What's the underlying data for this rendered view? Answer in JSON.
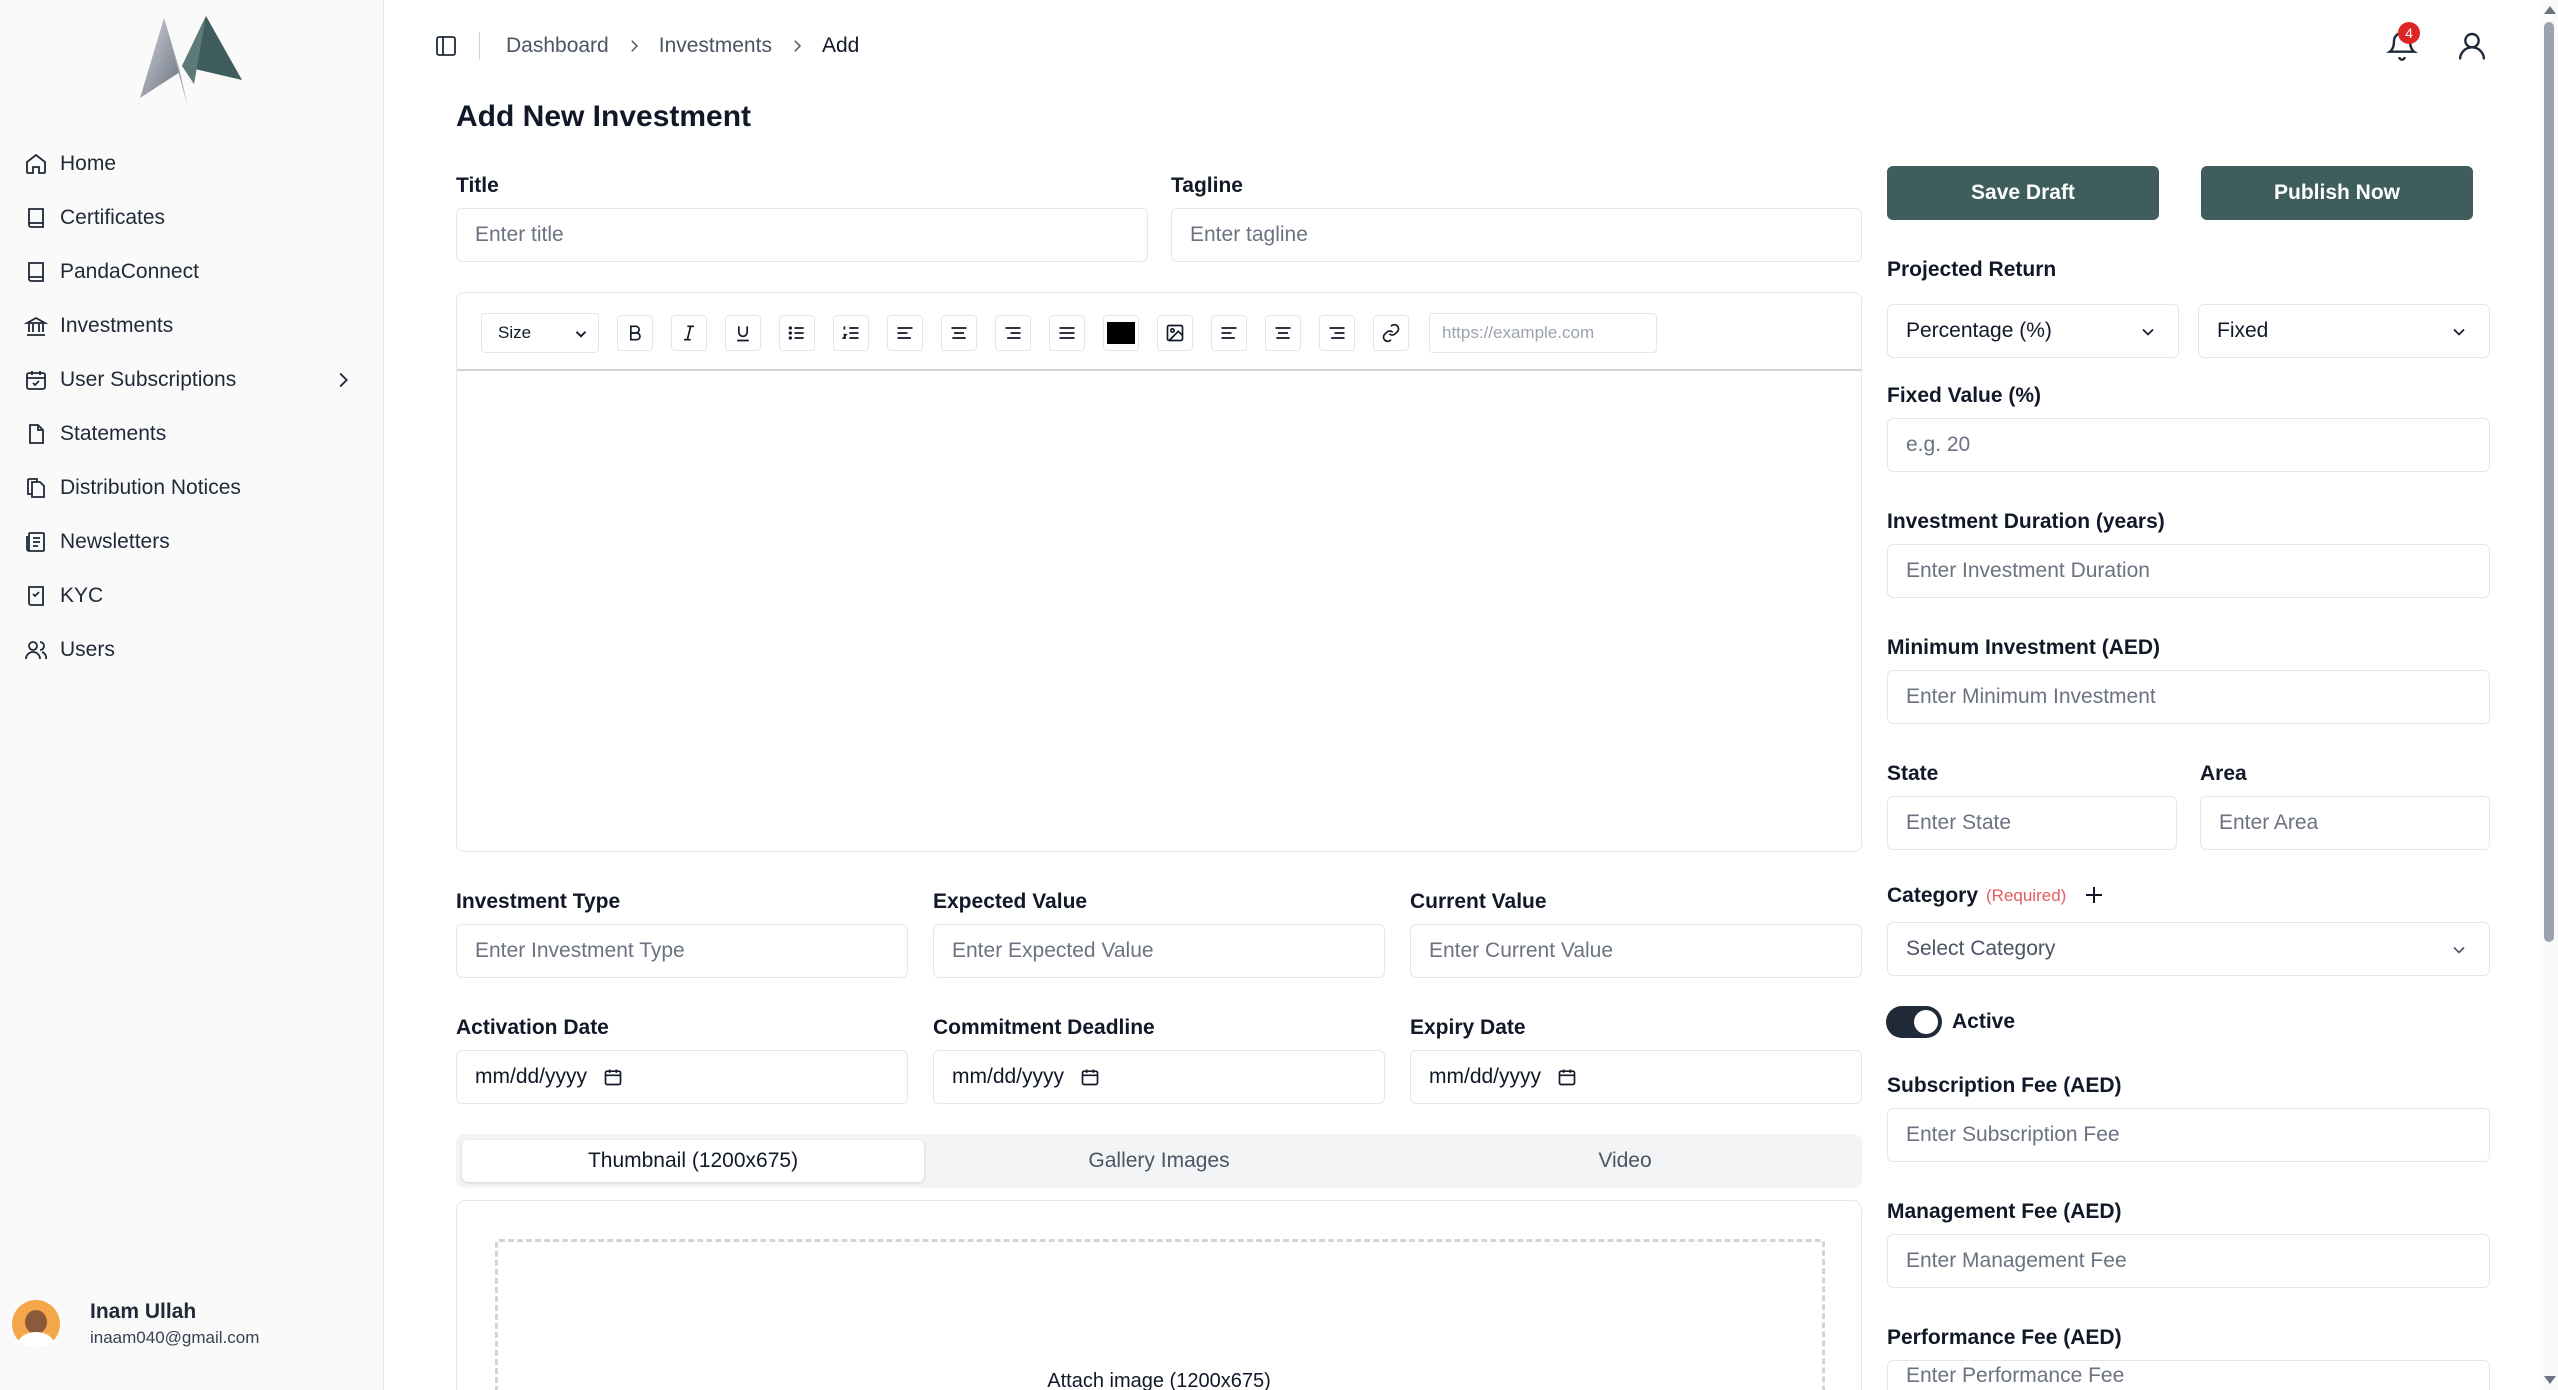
{
  "sidebar": {
    "items": [
      {
        "label": "Home",
        "icon": "home-icon"
      },
      {
        "label": "Certificates",
        "icon": "book-icon"
      },
      {
        "label": "PandaConnect",
        "icon": "book-icon"
      },
      {
        "label": "Investments",
        "icon": "bank-icon"
      },
      {
        "label": "User Subscriptions",
        "icon": "calendar-icon"
      },
      {
        "label": "Statements",
        "icon": "file-icon"
      },
      {
        "label": "Distribution Notices",
        "icon": "files-icon"
      },
      {
        "label": "Newsletters",
        "icon": "newspaper-icon"
      },
      {
        "label": "KYC",
        "icon": "check-book-icon"
      },
      {
        "label": "Users",
        "icon": "users-icon"
      }
    ],
    "user": {
      "name": "Inam Ullah",
      "email": "inaam040@gmail.com"
    }
  },
  "header": {
    "breadcrumb": [
      "Dashboard",
      "Investments",
      "Add"
    ],
    "notification_count": "4"
  },
  "page": {
    "title": "Add New Investment"
  },
  "form": {
    "title": {
      "label": "Title",
      "placeholder": "Enter title"
    },
    "tagline": {
      "label": "Tagline",
      "placeholder": "Enter tagline"
    },
    "editor": {
      "size_label": "Size",
      "url_placeholder": "https://example.com",
      "color": "#000000"
    },
    "investment_type": {
      "label": "Investment Type",
      "placeholder": "Enter Investment Type"
    },
    "expected_value": {
      "label": "Expected Value",
      "placeholder": "Enter Expected Value"
    },
    "current_value": {
      "label": "Current Value",
      "placeholder": "Enter Current Value"
    },
    "activation_date": {
      "label": "Activation Date",
      "value": "mm/dd/yyyy"
    },
    "commitment_deadline": {
      "label": "Commitment Deadline",
      "value": "mm/dd/yyyy"
    },
    "expiry_date": {
      "label": "Expiry Date",
      "value": "mm/dd/yyyy"
    },
    "tabs": [
      "Thumbnail (1200x675)",
      "Gallery Images",
      "Video"
    ],
    "upload_text": "Attach image (1200x675)"
  },
  "side_form": {
    "save_draft": "Save Draft",
    "publish_now": "Publish Now",
    "projected_return": {
      "label": "Projected Return",
      "unit": "Percentage (%)",
      "mode": "Fixed"
    },
    "fixed_value": {
      "label": "Fixed Value (%)",
      "placeholder": "e.g. 20"
    },
    "duration": {
      "label": "Investment Duration (years)",
      "placeholder": "Enter Investment Duration"
    },
    "minimum": {
      "label": "Minimum Investment (AED)",
      "placeholder": "Enter Minimum Investment"
    },
    "state": {
      "label": "State",
      "placeholder": "Enter State"
    },
    "area": {
      "label": "Area",
      "placeholder": "Enter Area"
    },
    "category": {
      "label": "Category",
      "required": "(Required)",
      "placeholder": "Select Category"
    },
    "active_label": "Active",
    "subscription_fee": {
      "label": "Subscription Fee (AED)",
      "placeholder": "Enter Subscription Fee"
    },
    "management_fee": {
      "label": "Management Fee (AED)",
      "placeholder": "Enter Management Fee"
    },
    "performance_fee": {
      "label": "Performance Fee (AED)",
      "placeholder": "Enter Performance Fee"
    }
  },
  "colors": {
    "primary_button": "#3f5d5c",
    "badge": "#dc2626",
    "required": "#e35d5d"
  }
}
